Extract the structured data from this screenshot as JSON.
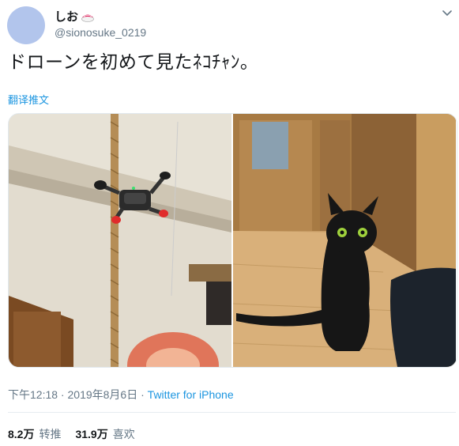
{
  "user": {
    "display_name": "しお",
    "handle": "@sionosuke_0219",
    "badge_icon": "sushi-icon",
    "avatar_color": "#b2c5ec"
  },
  "tweet": {
    "text": "ドローンを初めて見たﾈｺﾁｬﾝ。",
    "translate_label": "翻译推文"
  },
  "media": {
    "images": [
      {
        "name": "drone-photo"
      },
      {
        "name": "black-cat-photo"
      }
    ]
  },
  "meta": {
    "time": "下午12:18",
    "separator": " · ",
    "date": "2019年8月6日",
    "separator2": " · ",
    "client": "Twitter for iPhone"
  },
  "stats": {
    "retweets_count": "8.2万",
    "retweets_label": "转推",
    "likes_count": "31.9万",
    "likes_label": "喜欢"
  },
  "colors": {
    "link": "#1b95e0",
    "muted": "#657786",
    "text": "#14171a"
  }
}
